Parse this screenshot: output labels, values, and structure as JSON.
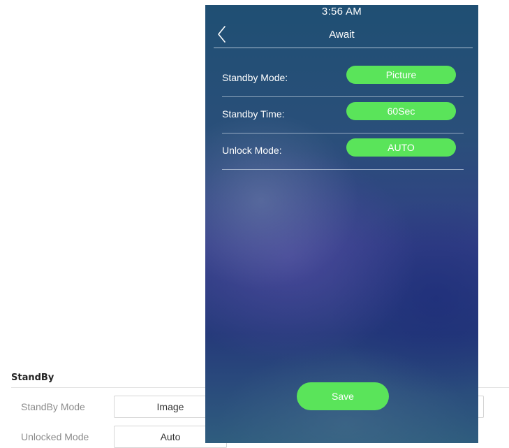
{
  "web_settings": {
    "section_title": "StandBy",
    "fields": [
      {
        "label": "StandBy Mode",
        "value": "Image"
      },
      {
        "label": "Unlocked Mode",
        "value": "Auto"
      }
    ]
  },
  "device_screen": {
    "status_time": "3:56 AM",
    "title": "Await",
    "back_icon": "chevron-left-icon",
    "rows": [
      {
        "label": "Standby Mode:",
        "value": "Picture"
      },
      {
        "label": "Standby Time:",
        "value": "60Sec"
      },
      {
        "label": "Unlock Mode:",
        "value": "AUTO"
      }
    ],
    "save_label": "Save"
  },
  "colors": {
    "accent_green": "#5ae45a",
    "screen_top": "#1f4f73",
    "screen_mid": "#323f86"
  }
}
